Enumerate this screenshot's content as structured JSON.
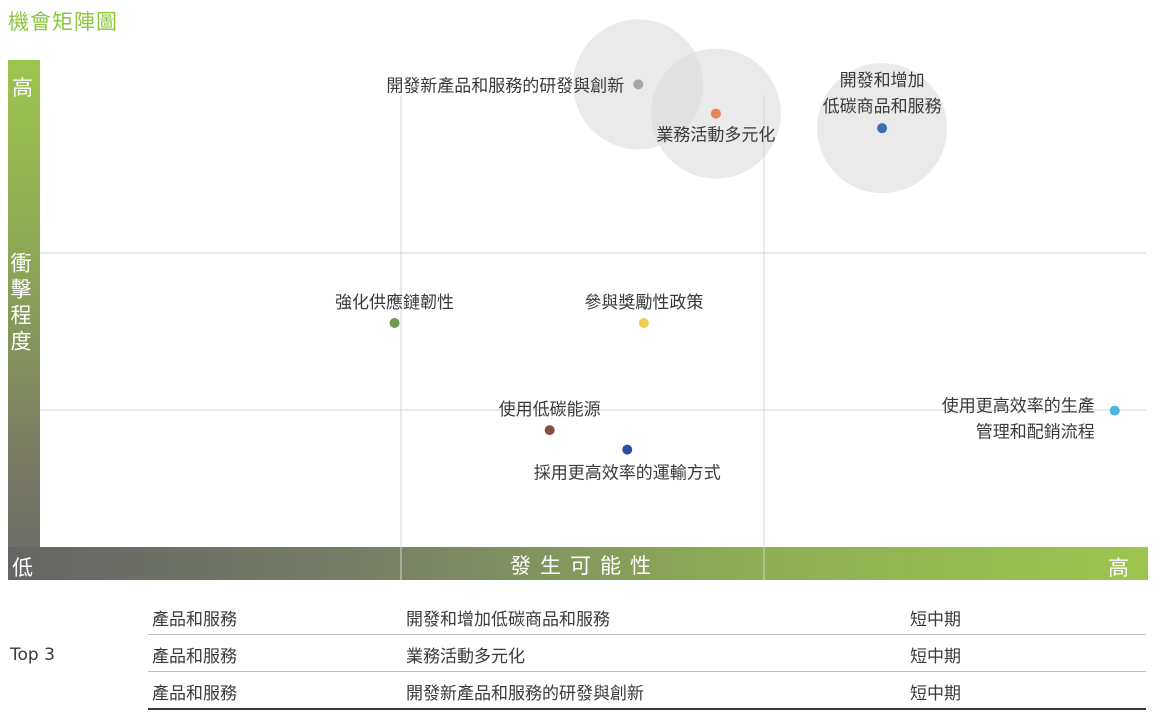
{
  "page": {
    "title": "機會矩陣圖"
  },
  "chart_data": {
    "type": "scatter",
    "ylabel": "衝擊程度",
    "xlabel": "發生可能性",
    "y_high": "高",
    "y_low": "低",
    "x_high": "高",
    "xlim": [
      0,
      1
    ],
    "ylim": [
      0,
      1
    ],
    "grid": true,
    "points": [
      {
        "label": [
          "開發新產品和服務的研發與創新"
        ],
        "x": 0.54,
        "y": 0.95,
        "color": "#a6a6a6",
        "highlight": true
      },
      {
        "label": [
          "業務活動多元化"
        ],
        "x": 0.61,
        "y": 0.89,
        "color": "#e8835a",
        "highlight": true
      },
      {
        "label": [
          "開發和增加",
          "低碳商品和服務"
        ],
        "x": 0.76,
        "y": 0.86,
        "color": "#3d6db3",
        "highlight": true
      },
      {
        "label": [
          "強化供應鏈韌性"
        ],
        "x": 0.32,
        "y": 0.46,
        "color": "#6b9a4f",
        "highlight": false
      },
      {
        "label": [
          "參與獎勵性政策"
        ],
        "x": 0.545,
        "y": 0.46,
        "color": "#f1cd52",
        "highlight": false
      },
      {
        "label": [
          "使用低碳能源"
        ],
        "x": 0.46,
        "y": 0.24,
        "color": "#8b4c45",
        "highlight": false
      },
      {
        "label": [
          "採用更高效率的運輸方式"
        ],
        "x": 0.53,
        "y": 0.2,
        "color": "#2d4f9e",
        "highlight": false
      },
      {
        "label": [
          "使用更高效率的生產",
          "管理和配銷流程"
        ],
        "x": 0.97,
        "y": 0.28,
        "color": "#4fb3e0",
        "highlight": false
      }
    ]
  },
  "table": {
    "group_label": "Top 3",
    "rows": [
      {
        "category": "產品和服務",
        "item": "開發和增加低碳商品和服務",
        "term": "短中期"
      },
      {
        "category": "產品和服務",
        "item": "業務活動多元化",
        "term": "短中期"
      },
      {
        "category": "產品和服務",
        "item": "開發新產品和服務的研發與創新",
        "term": "短中期"
      }
    ]
  }
}
